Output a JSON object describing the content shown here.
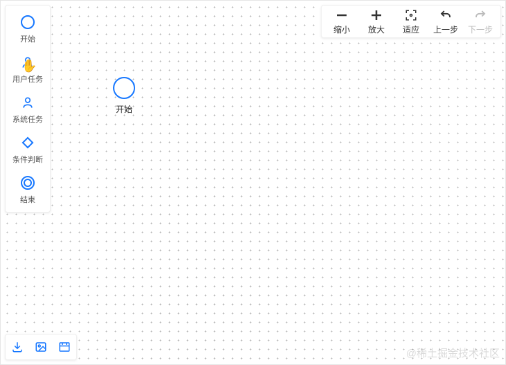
{
  "palette": {
    "items": [
      {
        "label": "开始"
      },
      {
        "label": "用户任务"
      },
      {
        "label": "系统任务"
      },
      {
        "label": "条件判断"
      },
      {
        "label": "结束"
      }
    ]
  },
  "toolbar": {
    "zoom_out": "缩小",
    "zoom_in": "放大",
    "fit": "适应",
    "undo": "上一步",
    "redo": "下一步"
  },
  "canvas": {
    "node_label": "开始"
  },
  "watermark": "@稀土掘金技术社区",
  "colors": {
    "accent": "#1677ff"
  }
}
